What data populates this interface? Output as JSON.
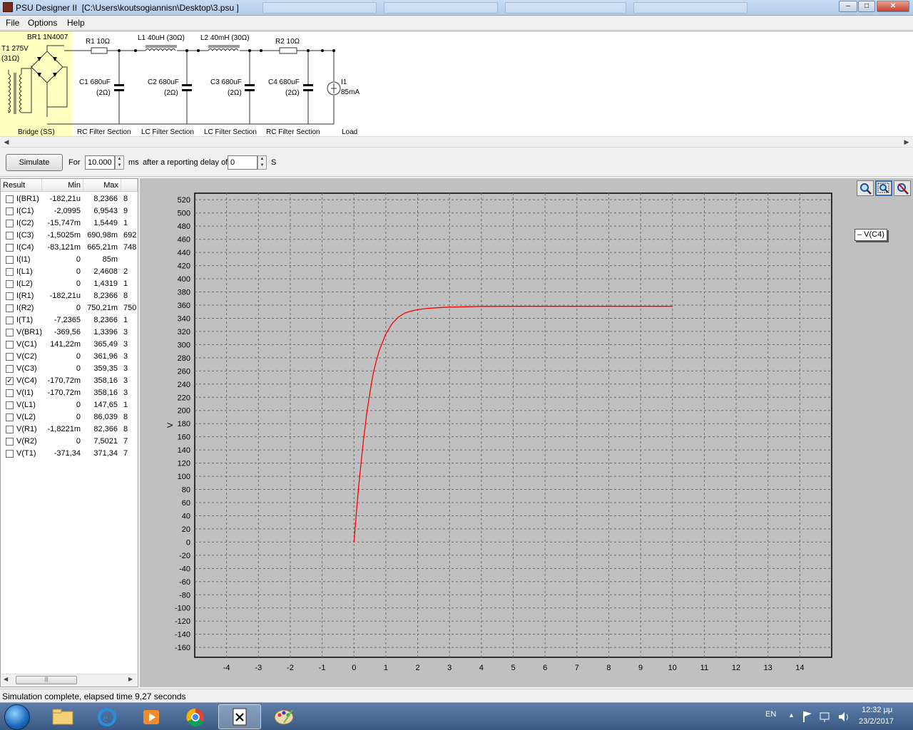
{
  "window": {
    "app_name": "PSU Designer II",
    "file_path": "[C:\\Users\\koutsogiannisn\\Desktop\\3.psu ]",
    "minimize": "–",
    "maximize": "□",
    "close": "✕"
  },
  "menu": [
    "File",
    "Options",
    "Help"
  ],
  "schematic": {
    "transformer_label": "T1 275V",
    "transformer_res": "(31Ω)",
    "bridge_label": "BR1 1N4007",
    "bridge_section": "Bridge (SS)",
    "r1": "R1 10Ω",
    "l1": "L1 40uH (30Ω)",
    "l2": "L2 40mH (30Ω)",
    "r2": "R2 10Ω",
    "c1": "C1 680uF",
    "c1_res": "(2Ω)",
    "c2": "C2 680uF",
    "c2_res": "(2Ω)",
    "c3": "C3 680uF",
    "c3_res": "(2Ω)",
    "c4": "C4 680uF",
    "c4_res": "(2Ω)",
    "load_name": "I1",
    "load_value": "85mA",
    "sections": [
      "RC Filter Section",
      "LC Filter Section",
      "LC Filter Section",
      "RC Filter Section",
      "Load"
    ]
  },
  "simulate": {
    "button": "Simulate",
    "for_label": "For",
    "duration": "10.000",
    "duration_unit": "ms",
    "delay_label": "after a reporting delay of",
    "delay": "0",
    "delay_unit": "S"
  },
  "results": {
    "columns": [
      "Result",
      "Min",
      "Max"
    ],
    "rows": [
      {
        "name": "I(BR1)",
        "min": "-182,21u",
        "max": "8,2366",
        "extra": "8",
        "checked": false
      },
      {
        "name": "I(C1)",
        "min": "-2,0995",
        "max": "6,9543",
        "extra": "9",
        "checked": false
      },
      {
        "name": "I(C2)",
        "min": "-15,747m",
        "max": "1,5449",
        "extra": "1",
        "checked": false
      },
      {
        "name": "I(C3)",
        "min": "-1,5025m",
        "max": "690,98m",
        "extra": "692",
        "checked": false
      },
      {
        "name": "I(C4)",
        "min": "-83,121m",
        "max": "665,21m",
        "extra": "748",
        "checked": false
      },
      {
        "name": "I(I1)",
        "min": "0",
        "max": "85m",
        "extra": "",
        "checked": false
      },
      {
        "name": "I(L1)",
        "min": "0",
        "max": "2,4608",
        "extra": "2",
        "checked": false
      },
      {
        "name": "I(L2)",
        "min": "0",
        "max": "1,4319",
        "extra": "1",
        "checked": false
      },
      {
        "name": "I(R1)",
        "min": "-182,21u",
        "max": "8,2366",
        "extra": "8",
        "checked": false
      },
      {
        "name": "I(R2)",
        "min": "0",
        "max": "750,21m",
        "extra": "750",
        "checked": false
      },
      {
        "name": "I(T1)",
        "min": "-7,2365",
        "max": "8,2366",
        "extra": "1",
        "checked": false
      },
      {
        "name": "V(BR1)",
        "min": "-369,56",
        "max": "1,3396",
        "extra": "3",
        "checked": false
      },
      {
        "name": "V(C1)",
        "min": "141,22m",
        "max": "365,49",
        "extra": "3",
        "checked": false
      },
      {
        "name": "V(C2)",
        "min": "0",
        "max": "361,96",
        "extra": "3",
        "checked": false
      },
      {
        "name": "V(C3)",
        "min": "0",
        "max": "359,35",
        "extra": "3",
        "checked": false
      },
      {
        "name": "V(C4)",
        "min": "-170,72m",
        "max": "358,16",
        "extra": "3",
        "checked": true
      },
      {
        "name": "V(I1)",
        "min": "-170,72m",
        "max": "358,16",
        "extra": "3",
        "checked": false
      },
      {
        "name": "V(L1)",
        "min": "0",
        "max": "147,65",
        "extra": "1",
        "checked": false
      },
      {
        "name": "V(L2)",
        "min": "0",
        "max": "86,039",
        "extra": "8",
        "checked": false
      },
      {
        "name": "V(R1)",
        "min": "-1,8221m",
        "max": "82,366",
        "extra": "8",
        "checked": false
      },
      {
        "name": "V(R2)",
        "min": "0",
        "max": "7,5021",
        "extra": "7",
        "checked": false
      },
      {
        "name": "V(T1)",
        "min": "-371,34",
        "max": "371,34",
        "extra": "7",
        "checked": false
      }
    ]
  },
  "chart_data": {
    "type": "line",
    "ylabel": "V",
    "xlabel": "",
    "xlim": [
      -5,
      15
    ],
    "ylim": [
      -175,
      530
    ],
    "xticks": [
      -4,
      -3,
      -2,
      -1,
      0,
      1,
      2,
      3,
      4,
      5,
      6,
      7,
      8,
      9,
      10,
      11,
      12,
      13,
      14
    ],
    "yticks": [
      520,
      500,
      480,
      460,
      440,
      420,
      400,
      380,
      360,
      340,
      320,
      300,
      280,
      260,
      240,
      220,
      200,
      180,
      160,
      140,
      120,
      100,
      80,
      60,
      40,
      20,
      0,
      -20,
      -40,
      -60,
      -80,
      -100,
      -120,
      -140,
      -160
    ],
    "grid": true,
    "series": [
      {
        "name": "V(C4)",
        "color": "#ff0000",
        "x": [
          0,
          0.05,
          0.1,
          0.15,
          0.2,
          0.3,
          0.4,
          0.5,
          0.6,
          0.7,
          0.8,
          1.0,
          1.2,
          1.4,
          1.6,
          1.8,
          2.0,
          2.3,
          2.6,
          3.0,
          3.5,
          4.0,
          5.0,
          6.0,
          7.0,
          8.0,
          9.0,
          10.0
        ],
        "y": [
          0,
          30,
          58,
          85,
          110,
          155,
          195,
          227,
          255,
          275,
          292,
          316,
          332,
          342,
          348,
          351,
          353,
          355,
          356,
          357,
          357.5,
          358,
          358.1,
          358.1,
          358.16,
          358.16,
          358.16,
          358.16
        ]
      }
    ]
  },
  "legend": {
    "label": "– V(C4)"
  },
  "status": {
    "text": "Simulation complete, elapsed time 9,27 seconds"
  },
  "tray": {
    "lang": "EN",
    "time": "12:32 μμ",
    "date": "23/2/2017",
    "up_arrow": "▲"
  }
}
